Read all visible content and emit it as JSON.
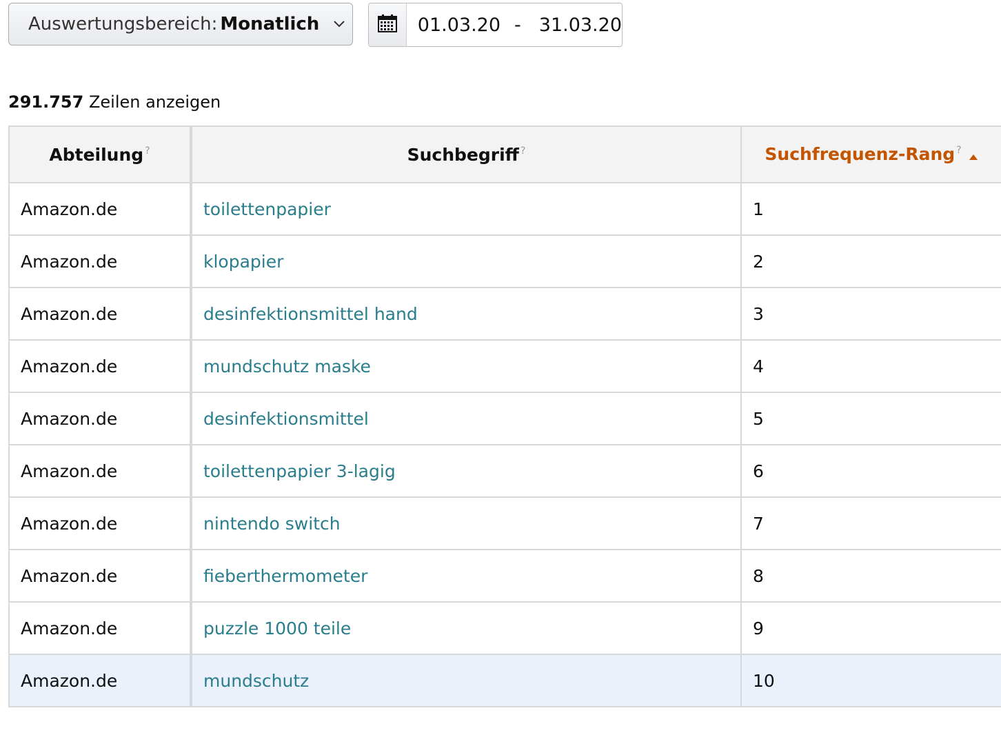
{
  "filters": {
    "range_prefix": "Auswertungsbereich:",
    "range_value": "Monatlich",
    "date_from": "01.03.20",
    "date_separator": "-",
    "date_to": "31.03.20"
  },
  "summary": {
    "row_count": "291.757",
    "row_count_suffix": "Zeilen anzeigen"
  },
  "table": {
    "columns": [
      {
        "label": "Abteilung",
        "help": "?"
      },
      {
        "label": "Suchbegriff",
        "help": "?"
      },
      {
        "label": "Suchfrequenz-Rang",
        "help": "?",
        "sorted": "ascending"
      }
    ],
    "rows": [
      {
        "department": "Amazon.de",
        "term": "toilettenpapier",
        "rank": "1"
      },
      {
        "department": "Amazon.de",
        "term": "klopapier",
        "rank": "2"
      },
      {
        "department": "Amazon.de",
        "term": "desinfektionsmittel hand",
        "rank": "3"
      },
      {
        "department": "Amazon.de",
        "term": "mundschutz maske",
        "rank": "4"
      },
      {
        "department": "Amazon.de",
        "term": "desinfektionsmittel",
        "rank": "5"
      },
      {
        "department": "Amazon.de",
        "term": "toilettenpapier 3-lagig",
        "rank": "6"
      },
      {
        "department": "Amazon.de",
        "term": "nintendo switch",
        "rank": "7"
      },
      {
        "department": "Amazon.de",
        "term": "fieberthermometer",
        "rank": "8"
      },
      {
        "department": "Amazon.de",
        "term": "puzzle 1000 teile",
        "rank": "9"
      },
      {
        "department": "Amazon.de",
        "term": "mundschutz",
        "rank": "10"
      }
    ]
  },
  "icons": {
    "dropdown": "chevron-down-icon",
    "calendar": "calendar-icon",
    "sort": "sort-ascending-icon"
  },
  "colors": {
    "link": "#2a7d8c",
    "active_header": "#c45500",
    "highlight_row": "#eaf1fb"
  }
}
